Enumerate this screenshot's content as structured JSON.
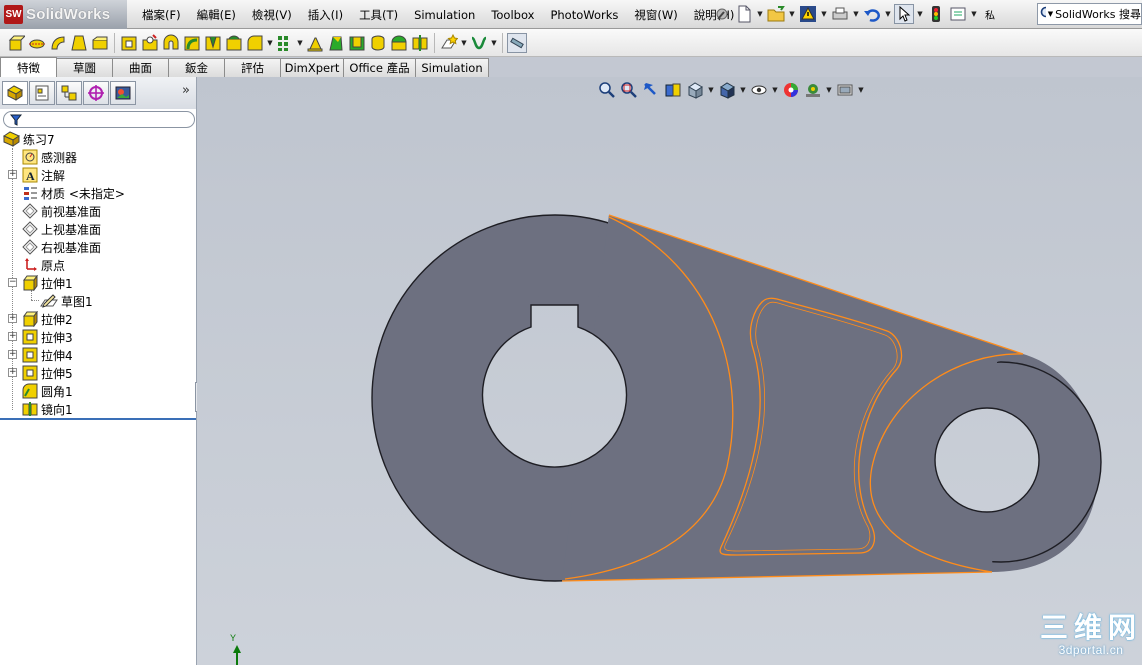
{
  "app": {
    "logo_mark": "SW",
    "logo_text": "SolidWorks",
    "brand_color": "#b01818"
  },
  "menu": {
    "items": [
      "檔案(F)",
      "編輯(E)",
      "檢視(V)",
      "插入(I)",
      "工具(T)",
      "Simulation",
      "Toolbox",
      "PhotoWorks",
      "視窗(W)",
      "說明(H)"
    ],
    "overflow_text": "私"
  },
  "search": {
    "placeholder": "SolidWorks 搜尋"
  },
  "command_tabs": {
    "items": [
      "特徵",
      "草圖",
      "曲面",
      "鈑金",
      "評估",
      "DimXpert",
      "Office 產品",
      "Simulation"
    ],
    "active": "特徵"
  },
  "feature_tree": {
    "root": "练习7",
    "nodes": [
      {
        "label": "感测器",
        "icon": "sensor-icon",
        "expandable": false
      },
      {
        "label": "注解",
        "icon": "annotation-icon",
        "expandable": true
      },
      {
        "label": "材质 <未指定>",
        "icon": "material-icon",
        "expandable": false
      },
      {
        "label": "前视基准面",
        "icon": "plane-icon",
        "expandable": false
      },
      {
        "label": "上视基准面",
        "icon": "plane-icon",
        "expandable": false
      },
      {
        "label": "右视基准面",
        "icon": "plane-icon",
        "expandable": false
      },
      {
        "label": "原点",
        "icon": "origin-icon",
        "expandable": false
      },
      {
        "label": "拉伸1",
        "icon": "extrude-icon",
        "expandable": true,
        "expanded": true
      },
      {
        "label": "草图1",
        "icon": "sketch-icon",
        "expandable": false,
        "child": true
      },
      {
        "label": "拉伸2",
        "icon": "extrude-icon",
        "expandable": true
      },
      {
        "label": "拉伸3",
        "icon": "extrude-icon",
        "expandable": true
      },
      {
        "label": "拉伸4",
        "icon": "extrude-icon",
        "expandable": true
      },
      {
        "label": "拉伸5",
        "icon": "extrude-icon",
        "expandable": true
      },
      {
        "label": "圆角1",
        "icon": "fillet-icon",
        "expandable": false
      },
      {
        "label": "镜向1",
        "icon": "mirror-icon",
        "expandable": false
      }
    ]
  },
  "panel": {
    "more_glyph": "»"
  },
  "viewport": {
    "triad_axis": "Y",
    "part_fill": "#6d7080",
    "edge_highlight": "#ff8c1a"
  },
  "watermark": {
    "main": "三维网",
    "sub": "3dportal.cn"
  }
}
